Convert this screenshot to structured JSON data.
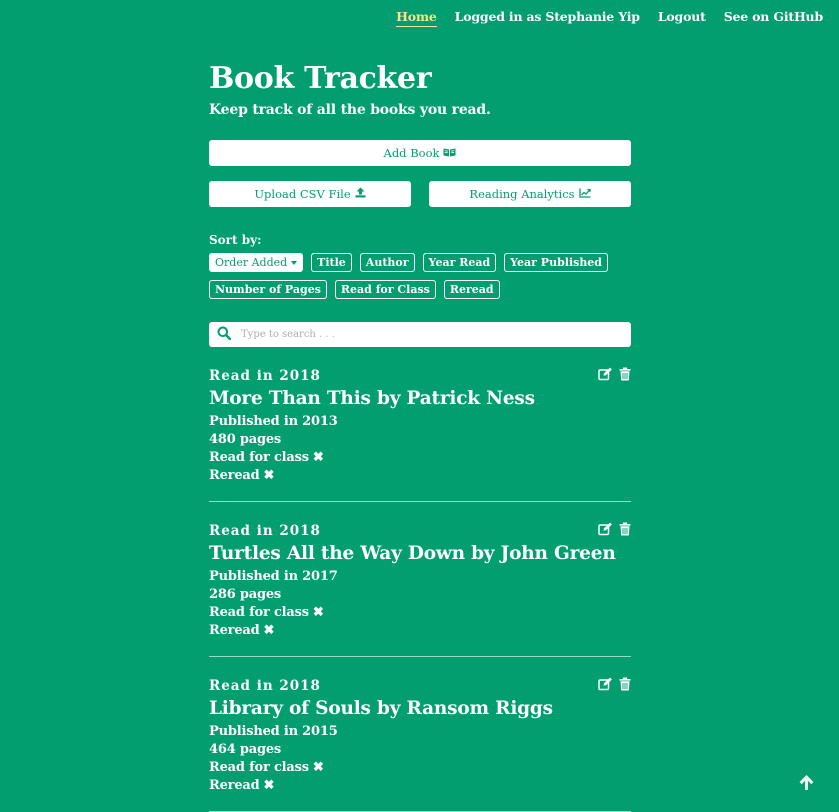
{
  "nav": {
    "home": "Home",
    "logged_in": "Logged in as Stephanie Yip",
    "logout": "Logout",
    "github": "See on GitHub"
  },
  "header": {
    "title": "Book Tracker",
    "subtitle": "Keep track of all the books you read."
  },
  "actions": {
    "add_book": "Add Book",
    "upload_csv": "Upload CSV File",
    "analytics": "Reading Analytics"
  },
  "sort": {
    "label": "Sort by:",
    "selected": "Order Added",
    "options": [
      "Title",
      "Author",
      "Year Read",
      "Year Published",
      "Number of Pages",
      "Read for Class",
      "Reread"
    ]
  },
  "search": {
    "placeholder": "Type to search . . ."
  },
  "books": [
    {
      "year_read": "Read in 2018",
      "title": "More Than This by Patrick Ness",
      "published": "Published in 2013",
      "pages": "480 pages",
      "read_for_class": "Read for class",
      "reread": "Reread"
    },
    {
      "year_read": "Read in 2018",
      "title": "Turtles All the Way Down by John Green",
      "published": "Published in 2017",
      "pages": "286 pages",
      "read_for_class": "Read for class",
      "reread": "Reread"
    },
    {
      "year_read": "Read in 2018",
      "title": "Library of Souls by Ransom Riggs",
      "published": "Published in 2015",
      "pages": "464 pages",
      "read_for_class": "Read for class",
      "reread": "Reread"
    }
  ],
  "colors": {
    "background": "#039e70",
    "active_nav": "#f7e38f",
    "text": "#ffffff"
  }
}
